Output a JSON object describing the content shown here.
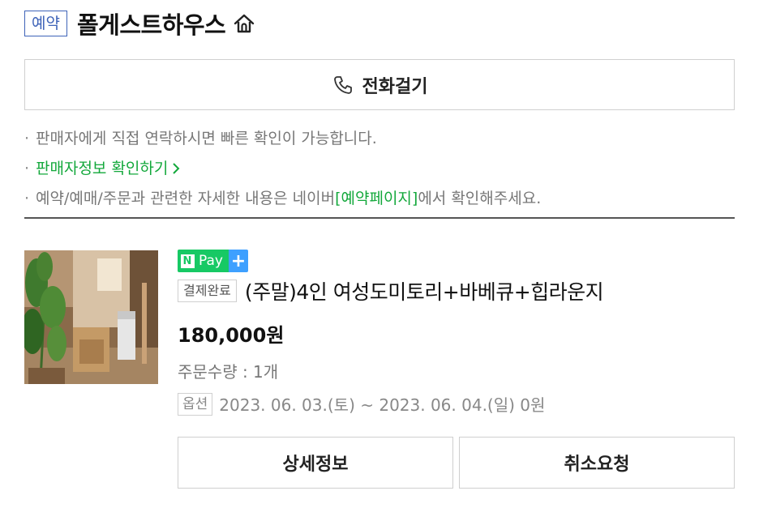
{
  "header": {
    "badge": "예약",
    "shop_name": "폴게스트하우스",
    "home_icon": "home-icon"
  },
  "call_button": {
    "label": "전화걸기",
    "icon": "phone-icon"
  },
  "notes": {
    "line1": "판매자에게 직접 연락하시면 빠른 확인이 가능합니다.",
    "seller_info_link": "판매자정보 확인하기",
    "line3_prefix": "예약/예매/주문과 관련한 자세한 내용은 네이버 ",
    "line3_link": "[예약페이지]",
    "line3_suffix": "에서 확인해주세요."
  },
  "order": {
    "payment_badge": {
      "n": "N",
      "pay": "Pay",
      "plus": "+"
    },
    "status": "결제완료",
    "title": "(주말)4인 여성도미토리+바베큐+힙라운지",
    "price": "180,000원",
    "quantity": "주문수량 : 1개",
    "option_tag": "옵션",
    "option_text": "2023. 06. 03.(토) ~ 2023. 06. 04.(일) 0원"
  },
  "actions": {
    "detail_label": "상세정보",
    "cancel_label": "취소요청"
  },
  "colors": {
    "badge_blue": "#3e63b8",
    "link_green": "#13a83b",
    "npay_green": "#17c964",
    "npay_blue": "#3ea0ff"
  }
}
